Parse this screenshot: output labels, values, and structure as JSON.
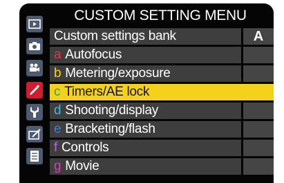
{
  "header": {
    "title": "CUSTOM SETTING MENU"
  },
  "sidebar": {
    "items": [
      {
        "icon": "playback-icon",
        "active": false
      },
      {
        "icon": "camera-icon",
        "active": false
      },
      {
        "icon": "movie-camera-icon",
        "active": false
      },
      {
        "icon": "pencil-icon",
        "active": true
      },
      {
        "icon": "wrench-icon",
        "active": false
      },
      {
        "icon": "retouch-icon",
        "active": false
      },
      {
        "icon": "my-menu-icon",
        "active": false
      }
    ]
  },
  "menu": {
    "bank_row": {
      "label": "Custom settings bank",
      "value": "A"
    },
    "items": [
      {
        "letter": "a",
        "label": "Autofocus",
        "letter_color": "#e8354a"
      },
      {
        "letter": "b",
        "label": "Metering/exposure",
        "letter_color": "#f4d11a"
      },
      {
        "letter": "c",
        "label": "Timers/AE lock",
        "letter_color": "#2aa64a",
        "selected": true
      },
      {
        "letter": "d",
        "label": "Shooting/display",
        "letter_color": "#4fb3e0"
      },
      {
        "letter": "e",
        "label": "Bracketing/flash",
        "letter_color": "#3c7ee0"
      },
      {
        "letter": "f",
        "label": "Controls",
        "letter_color": "#b267d6"
      },
      {
        "letter": "g",
        "label": "Movie",
        "letter_color": "#d63fb0"
      }
    ]
  },
  "colors": {
    "selected_bg": "#f4d11a",
    "row_bg": "#3e3e3e",
    "active_tab": "#cf1f2e",
    "tab_bg": "#4d5a70"
  }
}
